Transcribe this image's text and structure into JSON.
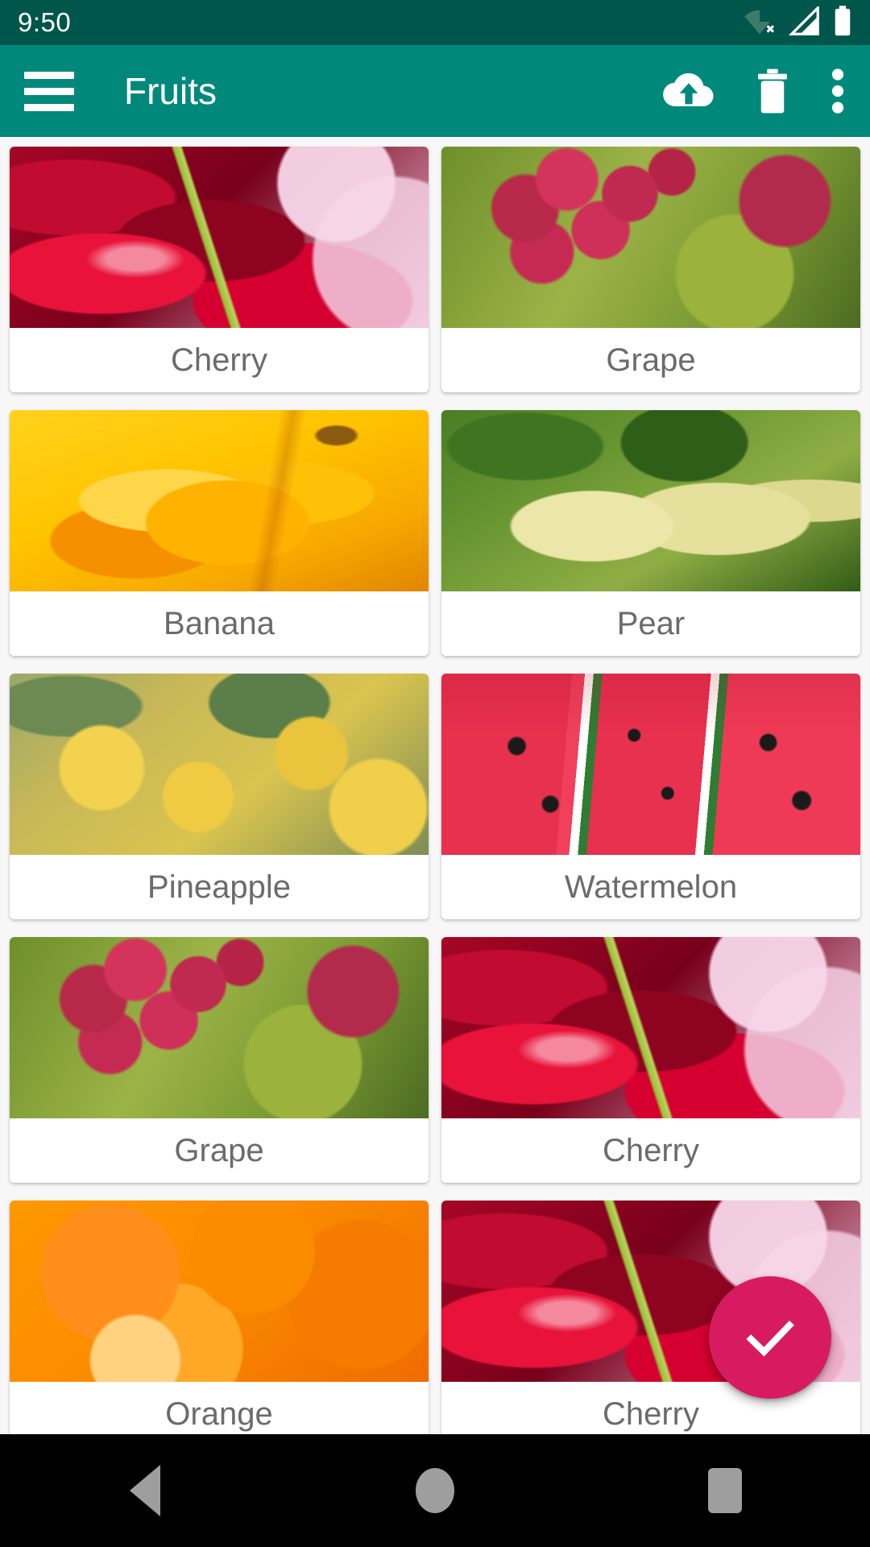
{
  "status_bar": {
    "time": "9:50",
    "background_color": "#00564a",
    "icons": [
      {
        "name": "wifi-off-icon",
        "label": "Wi-Fi disconnected"
      },
      {
        "name": "cellular-signal-icon",
        "label": "Mobile signal"
      },
      {
        "name": "battery-icon",
        "label": "Battery full"
      }
    ]
  },
  "app_bar": {
    "title": "Fruits",
    "background_color": "#00897b",
    "menu_icon": "hamburger-menu-icon",
    "actions": [
      {
        "name": "cloud-upload-icon",
        "label": "Upload"
      },
      {
        "name": "delete-icon",
        "label": "Delete"
      },
      {
        "name": "overflow-menu-icon",
        "label": "More options"
      }
    ]
  },
  "grid": {
    "columns": 2,
    "label_color": "#6b6b6b",
    "items": [
      {
        "label": "Cherry",
        "art": "ph-cherry"
      },
      {
        "label": "Grape",
        "art": "ph-grape"
      },
      {
        "label": "Banana",
        "art": "ph-banana"
      },
      {
        "label": "Pear",
        "art": "ph-pear"
      },
      {
        "label": "Pineapple",
        "art": "ph-pineapple"
      },
      {
        "label": "Watermelon",
        "art": "ph-watermelon"
      },
      {
        "label": "Grape",
        "art": "ph-grape"
      },
      {
        "label": "Cherry",
        "art": "ph-cherry"
      },
      {
        "label": "Orange",
        "art": "ph-orange"
      },
      {
        "label": "Cherry",
        "art": "ph-cherry"
      }
    ]
  },
  "fab": {
    "name": "confirm-fab",
    "icon": "check-icon",
    "color": "#d81b60"
  },
  "nav_bar": {
    "background_color": "#000000",
    "buttons": [
      {
        "name": "nav-back-button",
        "label": "Back"
      },
      {
        "name": "nav-home-button",
        "label": "Home"
      },
      {
        "name": "nav-recents-button",
        "label": "Recents"
      }
    ]
  }
}
